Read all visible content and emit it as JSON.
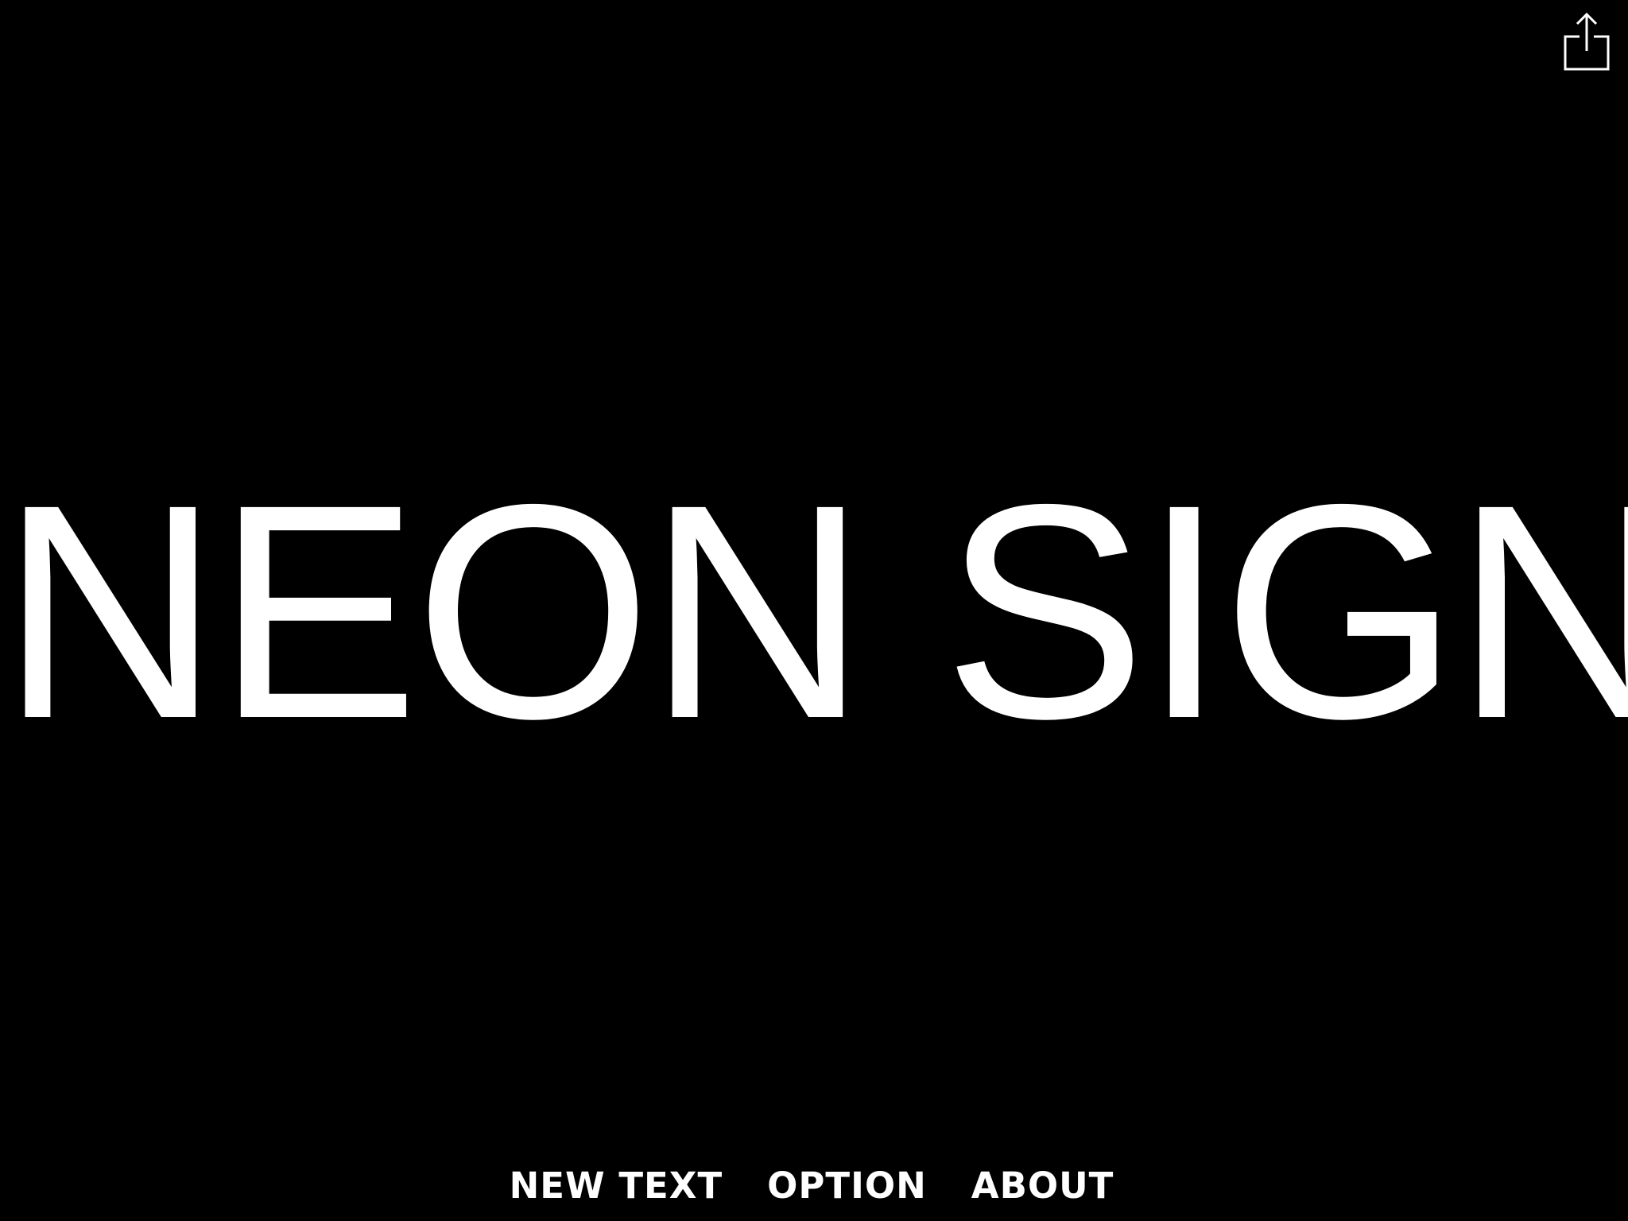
{
  "sign": {
    "text": "NEON SIGN",
    "color": "#ffffff",
    "background": "#000000"
  },
  "toolbar": {
    "share_icon": "share-icon"
  },
  "menu": {
    "items": [
      {
        "label": "NEW TEXT"
      },
      {
        "label": "OPTION"
      },
      {
        "label": "ABOUT"
      }
    ]
  }
}
